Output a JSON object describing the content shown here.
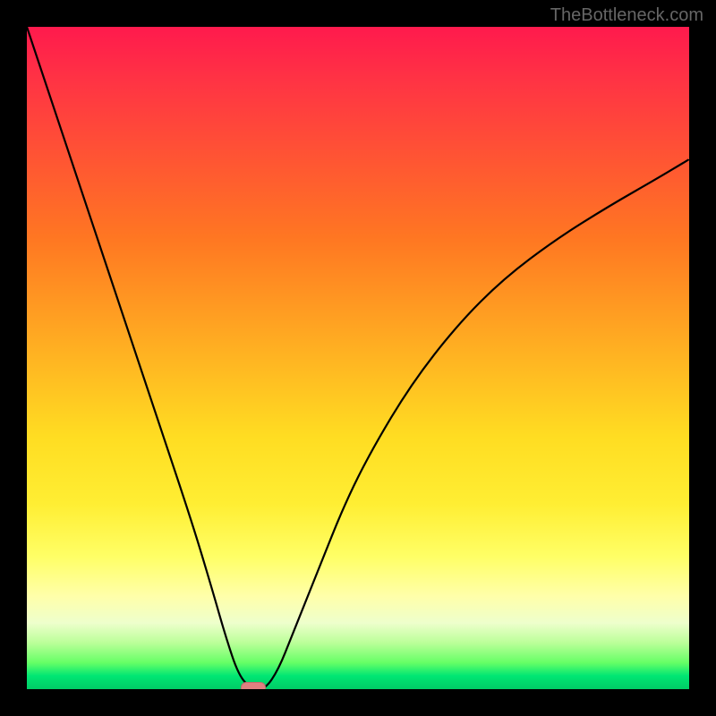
{
  "watermark": "TheBottleneck.com",
  "chart_data": {
    "type": "line",
    "title": "",
    "xlabel": "",
    "ylabel": "",
    "xlim": [
      0,
      100
    ],
    "ylim": [
      0,
      100
    ],
    "series": [
      {
        "name": "bottleneck-curve",
        "x": [
          0,
          5,
          10,
          15,
          20,
          25,
          28,
          30,
          32,
          34,
          36,
          38,
          40,
          44,
          48,
          52,
          58,
          65,
          72,
          80,
          88,
          95,
          100
        ],
        "values": [
          100,
          85,
          70,
          55,
          40,
          25,
          15,
          8,
          2,
          0,
          0,
          3,
          8,
          18,
          28,
          36,
          46,
          55,
          62,
          68,
          73,
          77,
          80
        ]
      }
    ],
    "marker": {
      "x_pct": 34,
      "y_pct": 0
    },
    "background_gradient": {
      "top": "#ff1a4d",
      "mid": "#ffee33",
      "bottom": "#00cc66"
    }
  }
}
